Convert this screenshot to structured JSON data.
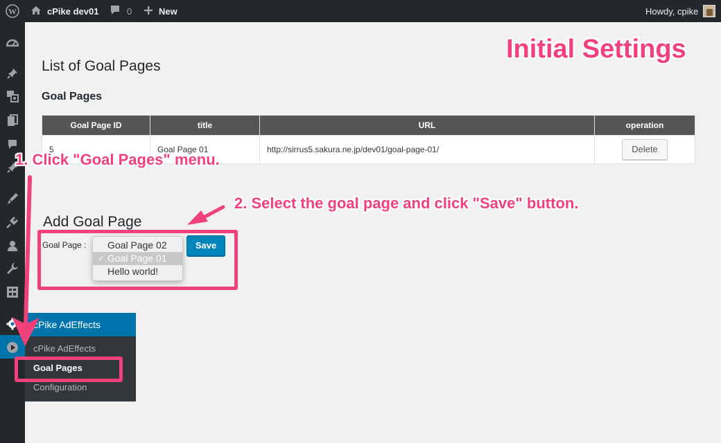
{
  "adminbar": {
    "site_name": "cPike dev01",
    "comments_count": "0",
    "new_label": "New",
    "greeting": "Howdy, cpike"
  },
  "flyout": {
    "header": "cPike AdEffects",
    "items": [
      "cPike AdEffects",
      "Goal Pages",
      "Configuration"
    ],
    "current": "Goal Pages"
  },
  "main": {
    "page_title": "List of Goal Pages",
    "section_title": "Goal Pages",
    "table": {
      "headers": [
        "Goal Page ID",
        "title",
        "URL",
        "operation"
      ],
      "rows": [
        {
          "id": "5",
          "title": "Goal Page 01",
          "url": "http://sirrus5.sakura.ne.jp/dev01/goal-page-01/",
          "action": "Delete"
        }
      ]
    },
    "add_title": "Add Goal Page",
    "goal_label": "Goal Page :",
    "select_options": [
      "Goal Page 02",
      "Goal Page 01",
      "Hello world!"
    ],
    "selected_option": "Goal Page 01",
    "check_mark": "✓",
    "save_label": "Save"
  },
  "annotations": {
    "heading": "Initial Settings",
    "step1": "1. Click \"Goal Pages\" menu.",
    "step2": "2. Select the goal page and click \"Save\" button."
  },
  "colors": {
    "accent": "#f0417a",
    "admin_dark": "#23282d",
    "wp_blue": "#0073aa",
    "save_blue": "#0085ba"
  }
}
